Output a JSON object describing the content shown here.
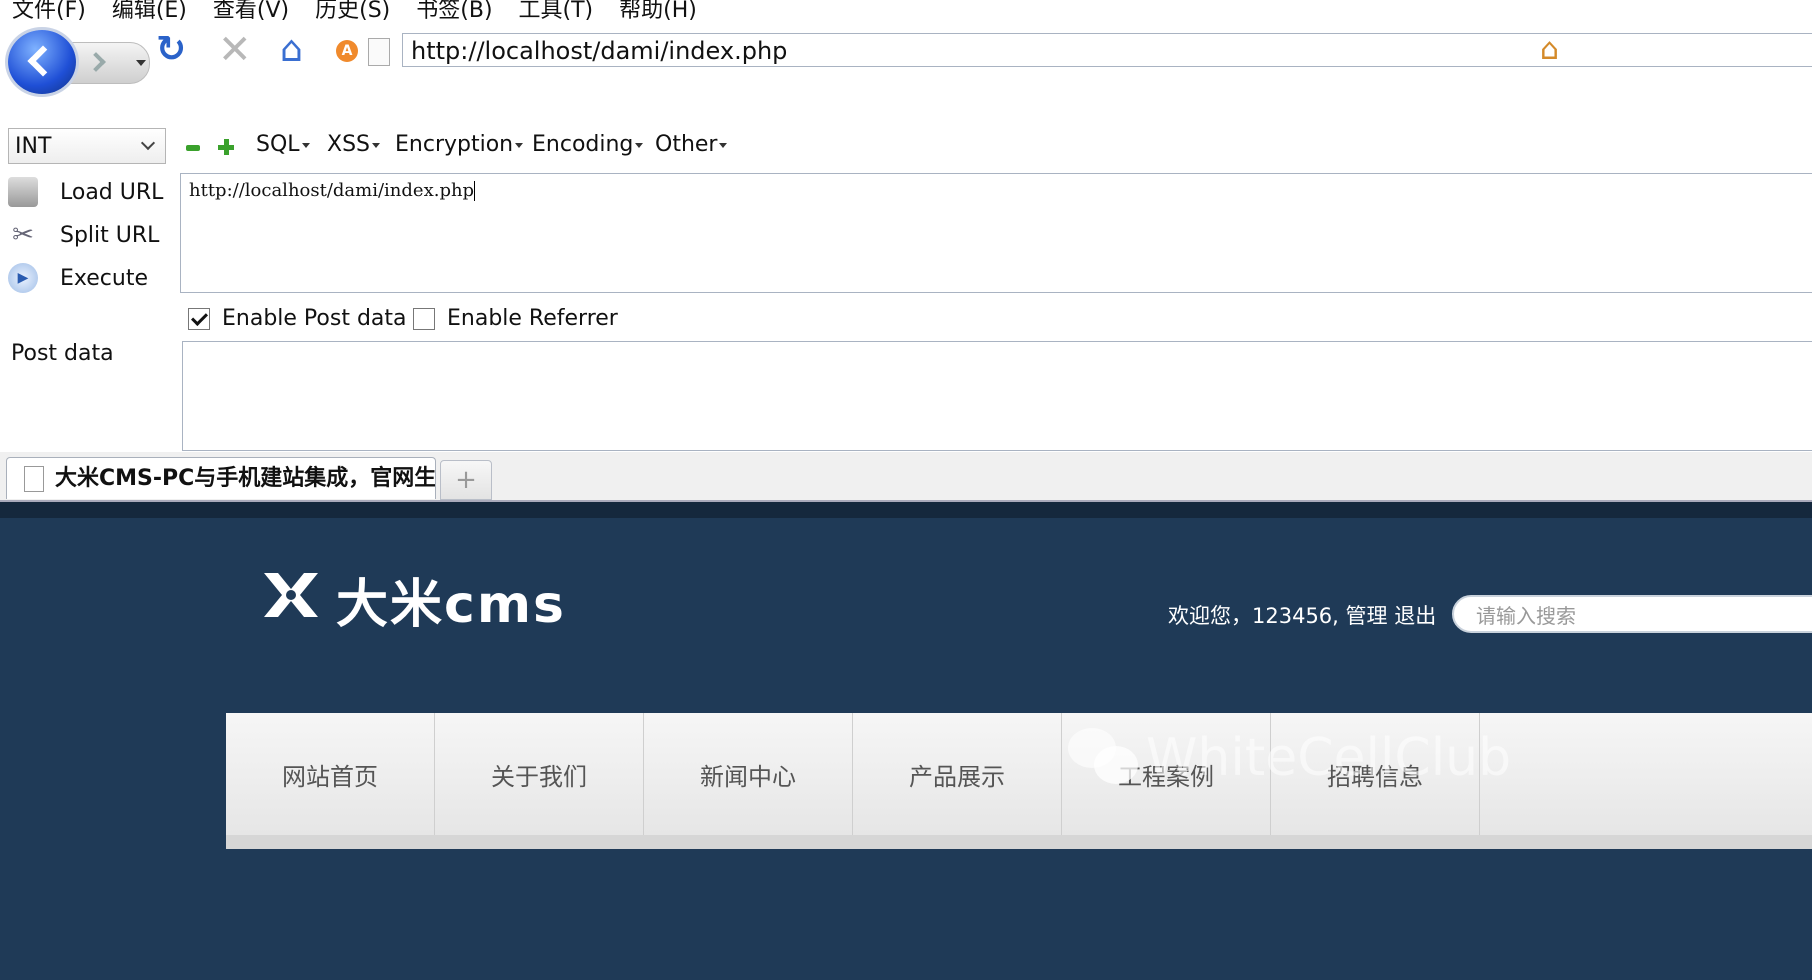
{
  "menu": [
    "文件(F)",
    "编辑(E)",
    "查看(V)",
    "历史(S)",
    "书签(B)",
    "工具(T)",
    "帮助(H)"
  ],
  "urlbar": {
    "value": "http://localhost/dami/index.php"
  },
  "hackbar": {
    "select_value": "INT",
    "menus": [
      "SQL",
      "XSS",
      "Encryption",
      "Encoding",
      "Other"
    ],
    "actions": [
      "Load URL",
      "Split URL",
      "Execute"
    ],
    "url_text": "http://localhost/dami/index.php",
    "enable_post": "Enable Post data",
    "enable_referrer": "Enable Referrer",
    "post_label": "Post data"
  },
  "tab": {
    "title": "大米CMS-PC与手机建站集成，官网生...",
    "new_tab": "+"
  },
  "site": {
    "logo_text": "大米cms",
    "welcome": "欢迎您，123456, 管理  退出",
    "search_placeholder": "请输入搜索",
    "nav": [
      "网站首页",
      "关于我们",
      "新闻中心",
      "产品展示",
      "工程案例",
      "招聘信息"
    ],
    "watermark": "WhiteCellClub"
  },
  "colors": {
    "site_bg": "#1f3a57",
    "accent_green": "#3aa12c",
    "back_blue": "#1f4fd6"
  }
}
